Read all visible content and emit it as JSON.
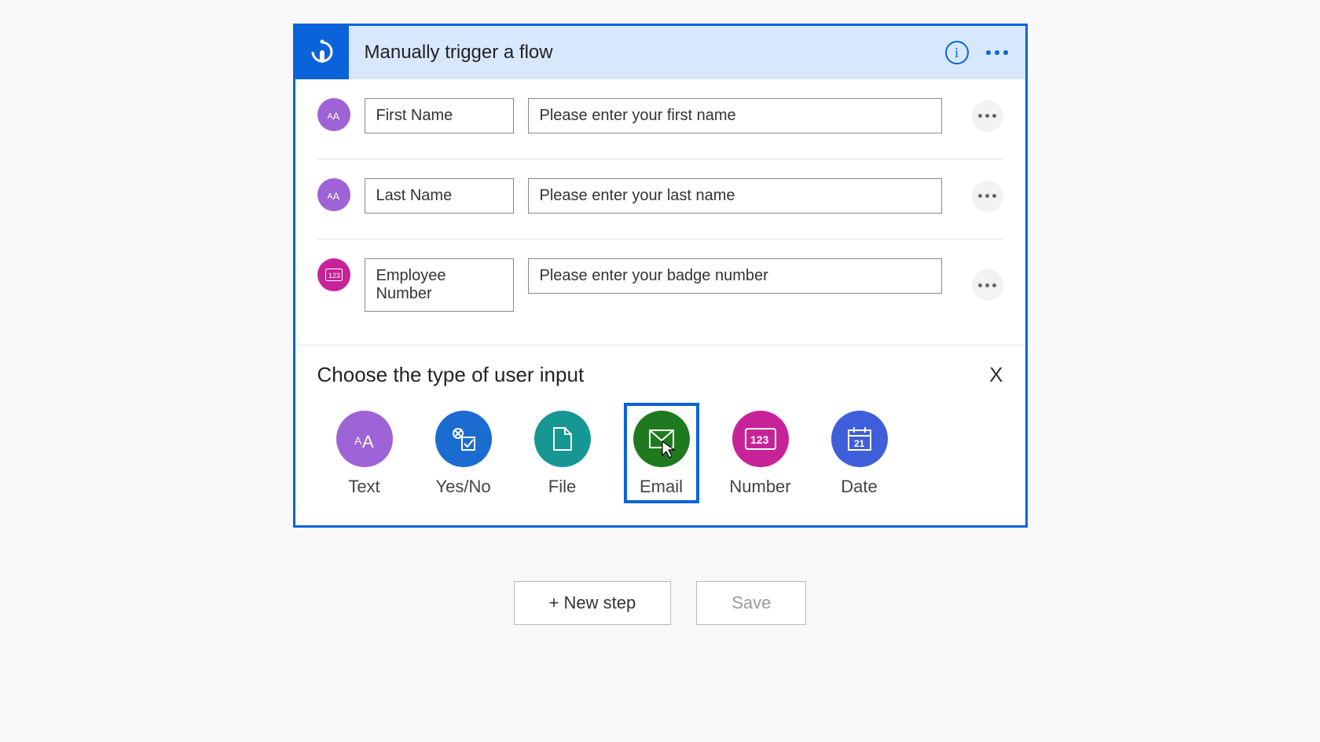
{
  "header": {
    "title": "Manually trigger a flow"
  },
  "inputs": [
    {
      "icon": "text",
      "name": "First Name",
      "prompt": "Please enter your first name"
    },
    {
      "icon": "text",
      "name": "Last Name",
      "prompt": "Please enter your last name"
    },
    {
      "icon": "number",
      "name": "Employee Number",
      "prompt": "Please enter your badge number"
    }
  ],
  "chooser": {
    "label": "Choose the type of user input",
    "close": "X",
    "types": [
      {
        "key": "text",
        "label": "Text"
      },
      {
        "key": "yesno",
        "label": "Yes/No"
      },
      {
        "key": "file",
        "label": "File"
      },
      {
        "key": "email",
        "label": "Email",
        "selected": true
      },
      {
        "key": "number",
        "label": "Number"
      },
      {
        "key": "date",
        "label": "Date"
      }
    ]
  },
  "footer": {
    "new_step": "+ New step",
    "save": "Save"
  }
}
